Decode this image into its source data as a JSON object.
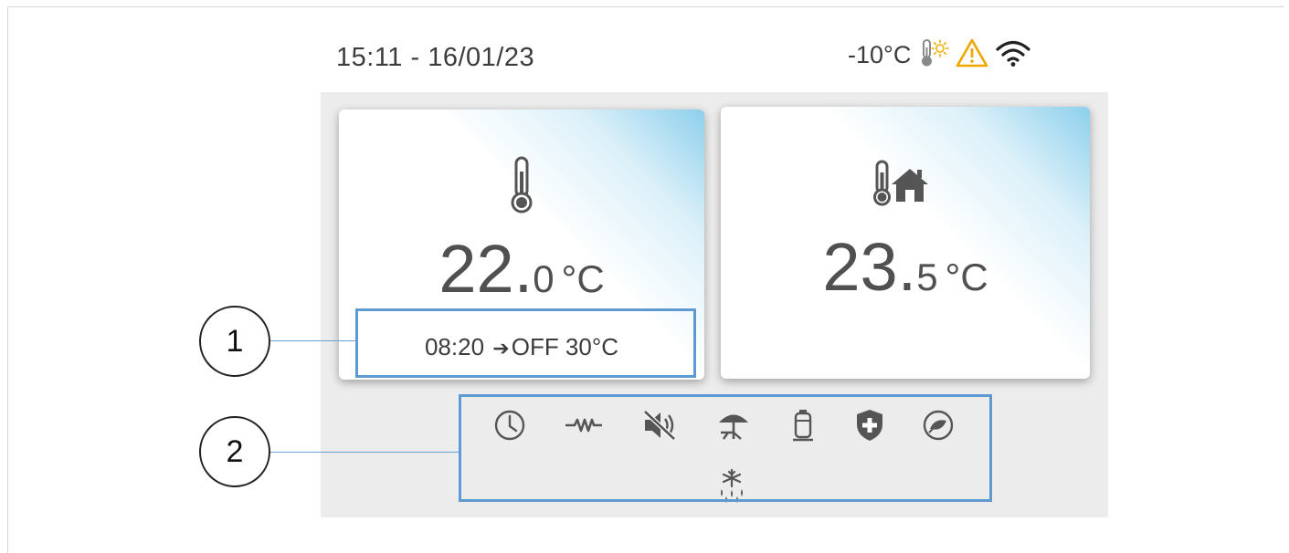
{
  "status_bar": {
    "datetime": "15:11 - 16/01/23",
    "outdoor_temp": "-10°C",
    "icons": [
      "thermometer-sun-icon",
      "warning-icon",
      "wifi-icon"
    ],
    "warning_color": "#f0a500"
  },
  "cards": [
    {
      "icon": "thermometer-icon",
      "value_int": "22",
      "value_dec": "0",
      "unit": "°C",
      "schedule": {
        "time": "08:20",
        "arrow": "➔",
        "action": "OFF 30°C"
      }
    },
    {
      "icon": "thermometer-house-icon",
      "value_int": "23",
      "value_dec": "5",
      "unit": "°C"
    }
  ],
  "status_icons": [
    "clock-icon",
    "heater-resistance-icon",
    "mute-icon",
    "beach-umbrella-icon",
    "water-tank-icon",
    "shield-icon",
    "eco-leaf-icon",
    "defrost-icon"
  ],
  "callouts": [
    {
      "number": "1"
    },
    {
      "number": "2"
    }
  ],
  "colors": {
    "callout_border": "#5c9ad1",
    "card_gradient": "#87cdeb",
    "panel_bg": "#ececec",
    "text": "#444444"
  }
}
